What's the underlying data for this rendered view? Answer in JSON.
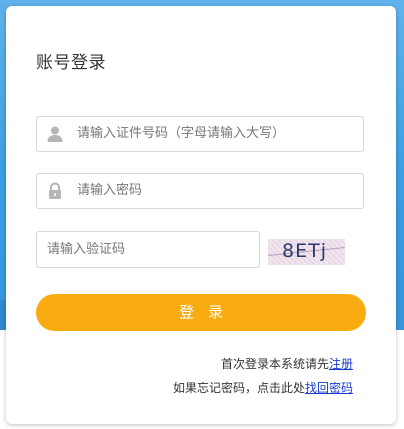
{
  "login": {
    "title": "账号登录",
    "id_placeholder": "请输入证件号码（字母请输入大写）",
    "password_placeholder": "请输入密码",
    "captcha_placeholder": "请输入验证码",
    "captcha_text": "8ETj",
    "button_label": "登录"
  },
  "footer": {
    "register_prefix": "首次登录本系统请先",
    "register_link": "注册",
    "forgot_prefix": "如果忘记密码，点击此处",
    "forgot_link": "找回密码"
  },
  "colors": {
    "accent": "#f9ac12",
    "link": "#1a3ccc",
    "background": "#3c9fe2"
  },
  "icons": {
    "user": "user-icon",
    "lock": "lock-icon"
  }
}
